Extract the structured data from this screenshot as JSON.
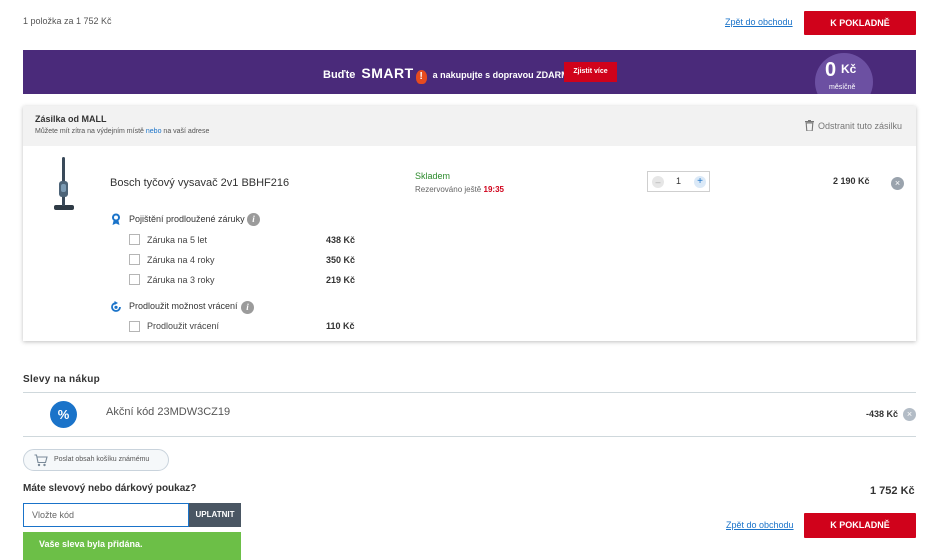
{
  "header": {
    "summary": "1 položka za 1 752 Kč",
    "back_link": "Zpět do obchodu",
    "checkout_button": "K POKLADNĚ"
  },
  "banner": {
    "text_prefix": "Buďte",
    "smart": "SMART",
    "text_suffix": "a nakupujte s dopravou ZDARMA.",
    "cta": "Zjistit více",
    "badge_value": "0",
    "badge_currency": "Kč",
    "badge_period": "měsíčně"
  },
  "shipment": {
    "title": "Zásilka od MALL",
    "subtitle_prefix": "Můžete mít zítra na výdejním místě",
    "subtitle_or": "nebo",
    "subtitle_suffix": "na vaší adrese",
    "remove_label": "Odstranit tuto zásilku",
    "product": {
      "name": "Bosch tyčový vysavač 2v1 BBHF216",
      "stock": "Skladem",
      "reserved_label": "Rezervováno ještě",
      "reserved_time": "19:35",
      "quantity": "1",
      "price": "2 190 Kč"
    },
    "warranty": {
      "title": "Pojištění prodloužené záruky",
      "options": [
        {
          "label": "Záruka na 5 let",
          "price": "438 Kč"
        },
        {
          "label": "Záruka na 4 roky",
          "price": "350 Kč"
        },
        {
          "label": "Záruka na 3 roky",
          "price": "219 Kč"
        }
      ]
    },
    "returns": {
      "title": "Prodloužit možnost vrácení",
      "option": {
        "label": "Prodloužit vrácení",
        "price": "110 Kč"
      }
    }
  },
  "discounts": {
    "title": "Slevy na nákup",
    "icon_glyph": "%",
    "code_label": "Akční kód 23MDW3CZ19",
    "amount": "-438 Kč"
  },
  "share": {
    "label": "Poslat obsah košíku známému"
  },
  "voucher": {
    "question": "Máte slevový nebo dárkový poukaz?",
    "placeholder": "Vložte kód",
    "apply": "UPLATNIT",
    "success": "Vaše sleva byla přidána."
  },
  "footer": {
    "total": "1 752 Kč",
    "back_link": "Zpět do obchodu",
    "checkout_button": "K POKLADNĚ"
  },
  "colors": {
    "accent_red": "#d0021b",
    "brand_purple": "#4a2a7a",
    "link_blue": "#1a73c9",
    "success_green": "#6cbf47"
  }
}
